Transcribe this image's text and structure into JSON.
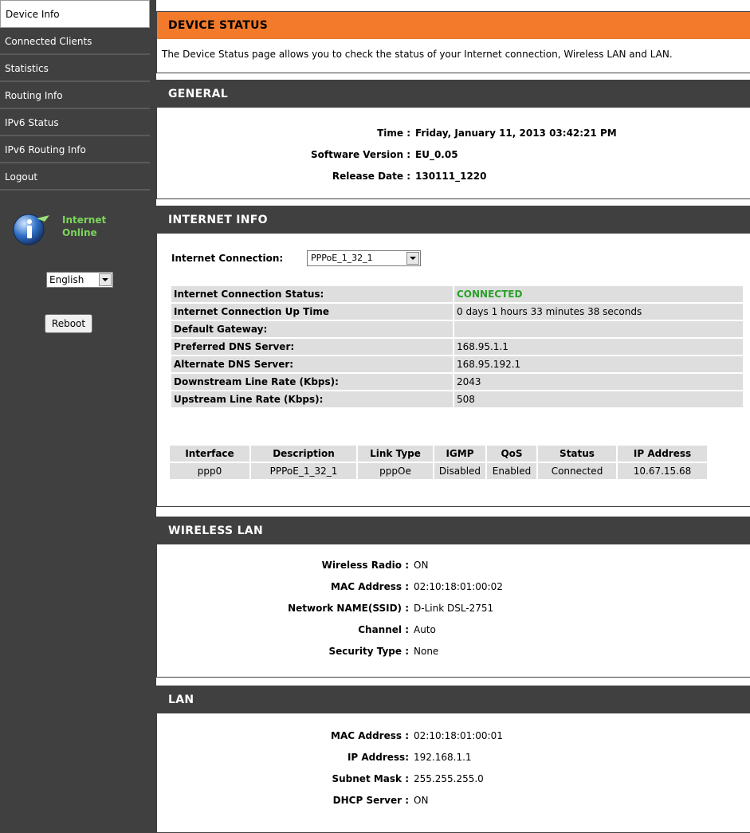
{
  "sidebar": {
    "items": [
      {
        "label": "Device Info"
      },
      {
        "label": "Connected Clients"
      },
      {
        "label": "Statistics"
      },
      {
        "label": "Routing Info"
      },
      {
        "label": "IPv6 Status"
      },
      {
        "label": "IPv6 Routing Info"
      },
      {
        "label": "Logout"
      }
    ],
    "status_line1": "Internet",
    "status_line2": "Online",
    "language": "English",
    "reboot_label": "Reboot"
  },
  "device_status": {
    "title": "DEVICE STATUS",
    "description": "The Device Status page allows you to check the status of your Internet connection, Wireless LAN and LAN."
  },
  "general": {
    "title": "GENERAL",
    "time_label": "Time :",
    "time_value": "Friday, January 11, 2013 03:42:21 PM",
    "software_label": "Software Version :",
    "software_value": "EU_0.05",
    "release_label": "Release Date :",
    "release_value": "130111_1220"
  },
  "internet_info": {
    "title": "INTERNET INFO",
    "connection_label": "Internet Connection:",
    "connection_value": "PPPoE_1_32_1",
    "rows": [
      {
        "label": "Internet Connection Status:",
        "value": "CONNECTED"
      },
      {
        "label": "Internet Connection Up Time",
        "value": "0 days 1 hours 33 minutes 38 seconds"
      },
      {
        "label": "Default Gateway:",
        "value": ""
      },
      {
        "label": "Preferred DNS Server:",
        "value": "168.95.1.1"
      },
      {
        "label": "Alternate DNS Server:",
        "value": "168.95.192.1"
      },
      {
        "label": "Downstream Line Rate (Kbps):",
        "value": "2043"
      },
      {
        "label": "Upstream Line Rate (Kbps):",
        "value": "508"
      }
    ],
    "iface_headers": [
      "Interface",
      "Description",
      "Link Type",
      "IGMP",
      "QoS",
      "Status",
      "IP Address"
    ],
    "iface_row": [
      "ppp0",
      "PPPoE_1_32_1",
      "pppOe",
      "Disabled",
      "Enabled",
      "Connected",
      "10.67.15.68"
    ]
  },
  "wireless": {
    "title": "WIRELESS LAN",
    "radio_label": "Wireless Radio :",
    "radio_value": "ON",
    "mac_label": "MAC Address :",
    "mac_value": "02:10:18:01:00:02",
    "ssid_label": "Network NAME(SSID) :",
    "ssid_value": "D-Link DSL-2751",
    "channel_label": "Channel :",
    "channel_value": "Auto",
    "security_label": "Security Type :",
    "security_value": "None"
  },
  "lan": {
    "title": "LAN",
    "mac_label": "MAC Address :",
    "mac_value": "02:10:18:01:00:01",
    "ip_label": "IP Address:",
    "ip_value": "192.168.1.1",
    "subnet_label": "Subnet Mask :",
    "subnet_value": "255.255.255.0",
    "dhcp_label": "DHCP Server :",
    "dhcp_value": "ON"
  }
}
